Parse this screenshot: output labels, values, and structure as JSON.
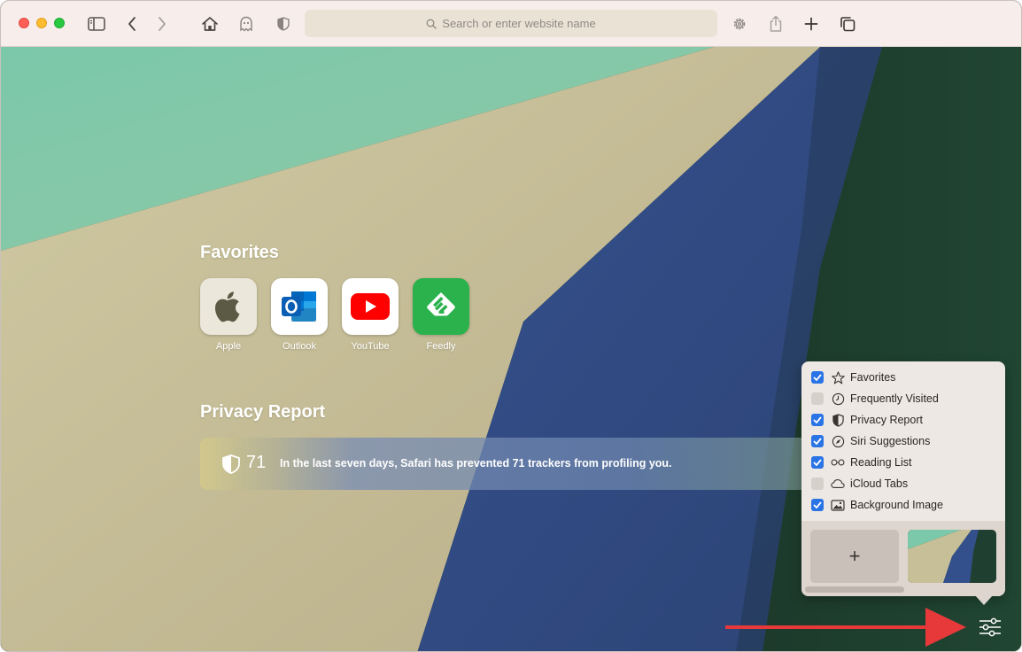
{
  "toolbar": {
    "search_placeholder": "Search or enter website name",
    "icons": [
      "sidebar-icon",
      "back-icon",
      "forward-icon",
      "home-icon",
      "ghostery-icon",
      "privacy-shield-icon",
      "settings-icon",
      "share-icon",
      "new-tab-icon",
      "tabs-overview-icon"
    ]
  },
  "favorites": {
    "title": "Favorites",
    "items": [
      {
        "label": "Apple",
        "icon": "apple-icon"
      },
      {
        "label": "Outlook",
        "icon": "outlook-icon"
      },
      {
        "label": "YouTube",
        "icon": "youtube-icon"
      },
      {
        "label": "Feedly",
        "icon": "feedly-icon"
      }
    ]
  },
  "privacy": {
    "title": "Privacy Report",
    "count": "71",
    "message": "In the last seven days, Safari has prevented 71 trackers from profiling you."
  },
  "popover": {
    "options": [
      {
        "label": "Favorites",
        "checked": true,
        "icon": "star-icon"
      },
      {
        "label": "Frequently Visited",
        "checked": false,
        "icon": "clock-icon"
      },
      {
        "label": "Privacy Report",
        "checked": true,
        "icon": "shield-icon"
      },
      {
        "label": "Siri Suggestions",
        "checked": true,
        "icon": "compass-icon"
      },
      {
        "label": "Reading List",
        "checked": true,
        "icon": "glasses-icon"
      },
      {
        "label": "iCloud Tabs",
        "checked": false,
        "icon": "cloud-icon"
      },
      {
        "label": "Background Image",
        "checked": true,
        "icon": "photo-icon"
      }
    ],
    "add_label": "+"
  },
  "colors": {
    "accent": "#2a74e6",
    "arrow": "#e8393a",
    "toolbar": "#f7eeec"
  }
}
